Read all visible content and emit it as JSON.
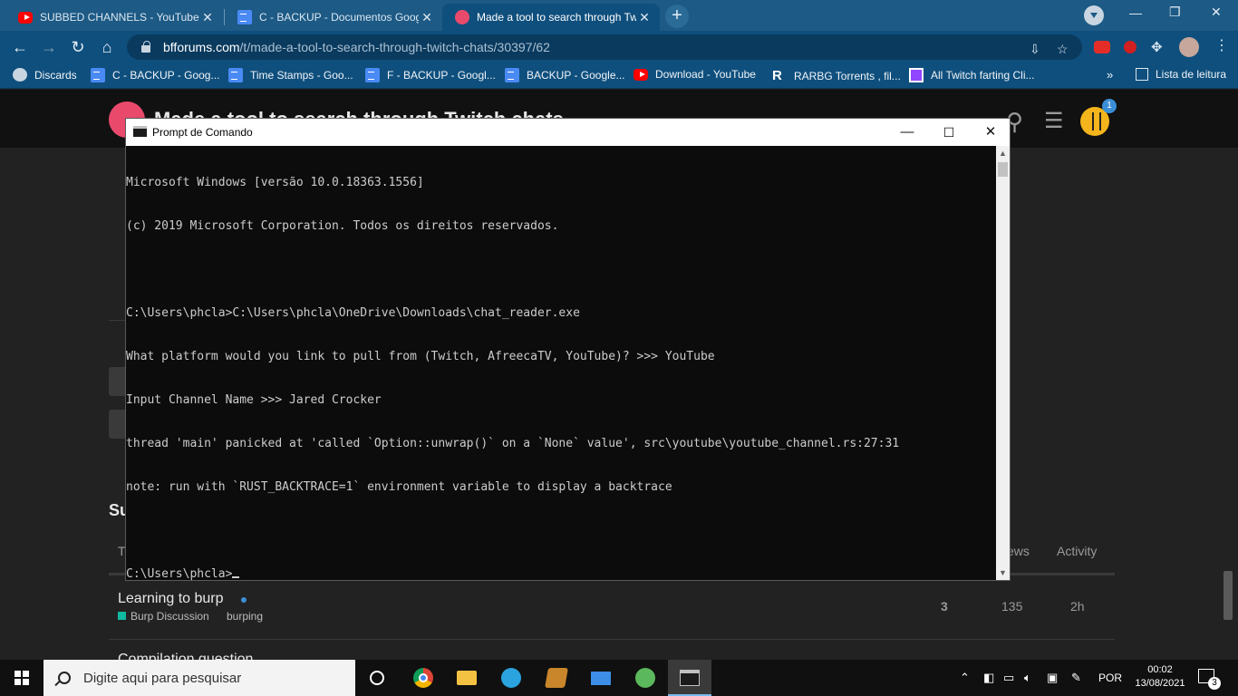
{
  "browser": {
    "tabs": [
      {
        "title": "SUBBED CHANNELS - YouTube",
        "favicon": "youtube-icon",
        "active": false
      },
      {
        "title": "C - BACKUP - Documentos Goog",
        "favicon": "google-docs-icon",
        "active": false
      },
      {
        "title": "Made a tool to search through Twitch",
        "favicon": "bfforums-icon",
        "active": true
      }
    ],
    "new_tab_label": "+",
    "url_host": "bfforums.com",
    "url_path": "/t/made-a-tool-to-search-through-twitch-chats/30397/62",
    "bookmarks": [
      {
        "label": "Discards",
        "icon": "discord-icon"
      },
      {
        "label": "C - BACKUP - Goog...",
        "icon": "google-docs-icon"
      },
      {
        "label": "Time Stamps - Goo...",
        "icon": "google-docs-icon"
      },
      {
        "label": "F - BACKUP - Googl...",
        "icon": "google-docs-icon"
      },
      {
        "label": "BACKUP - Google...",
        "icon": "google-docs-icon"
      },
      {
        "label": "Download - YouTube",
        "icon": "youtube-icon"
      },
      {
        "label": "RARBG Torrents , fil...",
        "icon": "rarbg-icon"
      },
      {
        "label": "All Twitch farting Cli...",
        "icon": "twitch-icon"
      }
    ],
    "bookmarks_overflow": "»",
    "reading_list_label": "Lista de leitura"
  },
  "forum": {
    "site_title": "Made a tool to search through Twitch chats",
    "notification_count": "1",
    "suggested_heading": "Su",
    "columns": {
      "topic": "T",
      "views": "ews",
      "activity": "Activity"
    },
    "topics": [
      {
        "title": "Learning to burp",
        "category": "Burp Discussion",
        "tag": "burping",
        "replies": "3",
        "views": "135",
        "activity": "2h"
      }
    ],
    "next_topic_partial": "Compilation question"
  },
  "cmd": {
    "window_title": "Prompt de Comando",
    "lines": [
      "Microsoft Windows [versão 10.0.18363.1556]",
      "(c) 2019 Microsoft Corporation. Todos os direitos reservados.",
      "",
      "C:\\Users\\phcla>C:\\Users\\phcla\\OneDrive\\Downloads\\chat_reader.exe",
      "What platform would you link to pull from (Twitch, AfreecaTV, YouTube)? >>> YouTube",
      "Input Channel Name >>> Jared Crocker",
      "thread 'main' panicked at 'called `Option::unwrap()` on a `None` value', src\\youtube\\youtube_channel.rs:27:31",
      "note: run with `RUST_BACKTRACE=1` environment variable to display a backtrace",
      ""
    ],
    "prompt": "C:\\Users\\phcla>"
  },
  "taskbar": {
    "search_placeholder": "Digite aqui para pesquisar",
    "language": "POR",
    "time": "00:02",
    "date": "13/08/2021",
    "notification_count": "3"
  }
}
